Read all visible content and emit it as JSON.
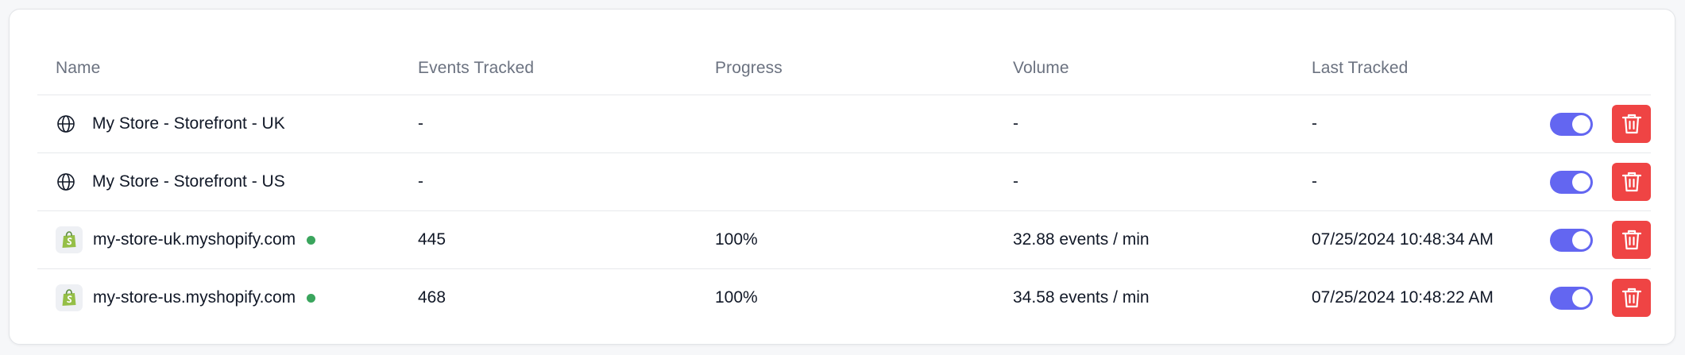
{
  "table": {
    "headers": {
      "name": "Name",
      "events": "Events Tracked",
      "progress": "Progress",
      "volume": "Volume",
      "last": "Last Tracked"
    },
    "rows": [
      {
        "icon": "globe-icon",
        "name": "My Store - Storefront - UK",
        "events": "-",
        "progress": "",
        "volume": "-",
        "last": "-",
        "enabled": true
      },
      {
        "icon": "globe-icon",
        "name": "My Store - Storefront - US",
        "events": "-",
        "progress": "",
        "volume": "-",
        "last": "-",
        "enabled": true
      },
      {
        "icon": "shopify-bag-icon",
        "name": "my-store-uk.myshopify.com",
        "status": "active",
        "events": "445",
        "progress": "100%",
        "volume": "32.88 events / min",
        "last": "07/25/2024 10:48:34 AM",
        "enabled": true
      },
      {
        "icon": "shopify-bag-icon",
        "name": "my-store-us.myshopify.com",
        "status": "active",
        "events": "468",
        "progress": "100%",
        "volume": "34.58 events / min",
        "last": "07/25/2024 10:48:22 AM",
        "enabled": true
      }
    ]
  },
  "colors": {
    "toggle_on": "#6366f1",
    "delete": "#ef4444",
    "status_active": "#3aa55d",
    "shopify_green": "#95bf47"
  }
}
